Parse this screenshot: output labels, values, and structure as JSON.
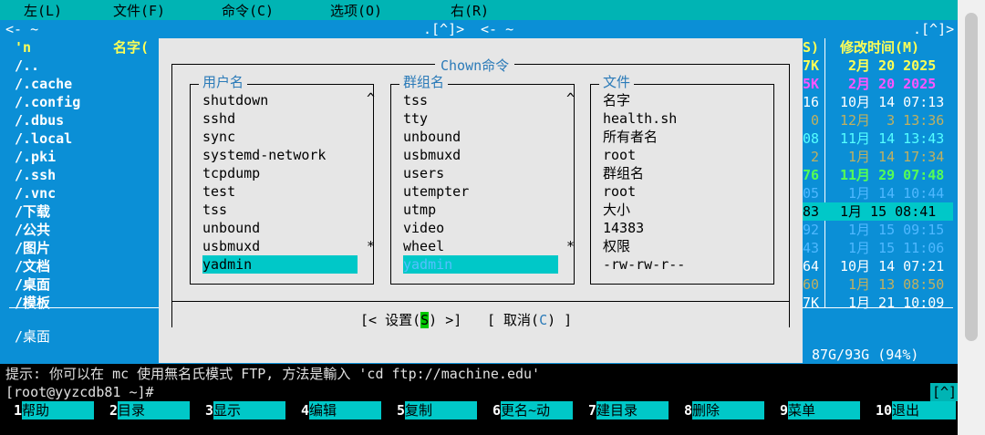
{
  "menu": [
    "左(L)",
    "文件(F)",
    "命令(C)",
    "选项(O)",
    "右(R)"
  ],
  "left_panel": {
    "path_left": "<- ~",
    "path_right": ".[^]>",
    "col_name_marker": "'n",
    "col_name": "名字(",
    "files": [
      "/..",
      "/.cache",
      "/.config",
      "/.dbus",
      "/.local",
      "/.pki",
      "/.ssh",
      "/.vnc",
      "/下载",
      "/公共",
      "/图片",
      "/文档",
      "/桌面",
      "/模板"
    ],
    "footer": "/桌面"
  },
  "right_panel": {
    "path_left": "<- ~",
    "path_right": ".[^]>",
    "col_size": "S)",
    "col_mtime": "修改时间(M)",
    "rows": [
      {
        "size": "7K",
        "time": "2月 20 2025",
        "color": "yellow"
      },
      {
        "size": "5K",
        "time": "2月 20 2025",
        "color": "magenta"
      },
      {
        "size": "16",
        "time": "10月 14 07:13",
        "color": "white"
      },
      {
        "size": "0",
        "time": "12月  3 13:36",
        "color": "olive"
      },
      {
        "size": "08",
        "time": "11月 14 13:43",
        "color": "cyan"
      },
      {
        "size": "2",
        "time": "1月 14 17:34",
        "color": "olive"
      },
      {
        "size": "76",
        "time": "11月 29 07:48",
        "color": "green"
      },
      {
        "size": "05",
        "time": "1月 14 10:44",
        "color": "lt"
      },
      {
        "size": "83",
        "time": "1月 15 08:41",
        "color": "selected"
      },
      {
        "size": "92",
        "time": "1月 15 09:15",
        "color": "lt"
      },
      {
        "size": "43",
        "time": "1月 15 11:06",
        "color": "lt"
      },
      {
        "size": "64",
        "time": "10月 14 07:21",
        "color": "white"
      },
      {
        "size": "60",
        "time": "1月 13 08:50",
        "color": "olive"
      },
      {
        "size": "7K",
        "time": "1月 21 10:09",
        "color": "white"
      }
    ],
    "footer": "87G/93G (94%)"
  },
  "dialog": {
    "title": "Chown命令",
    "user_label": "用户名",
    "users": [
      "shutdown",
      "sshd",
      "sync",
      "systemd-network",
      "tcpdump",
      "test",
      "tss",
      "unbound",
      "usbmuxd",
      "yadmin"
    ],
    "group_label": "群组名",
    "groups": [
      "tss",
      "tty",
      "unbound",
      "usbmuxd",
      "users",
      "utempter",
      "utmp",
      "video",
      "wheel",
      "yadmin"
    ],
    "file_label": "文件",
    "file_info": [
      "名字",
      "health.sh",
      "所有者名",
      "root",
      "群组名",
      "root",
      "大小",
      "14383",
      "权限",
      "-rw-rw-r--"
    ],
    "set_button": {
      "pre": "[< 设置(",
      "hot": "S",
      "post": ") >]"
    },
    "cancel_button": {
      "pre": "[ 取消(",
      "hot": "C",
      "post": ") ]"
    }
  },
  "hint": "提示: 你可以在 mc 使用無名氏模式 FTP, 方法是輸入 'cd ftp://machine.edu'",
  "prompt": "[root@yyzcdb81 ~]#",
  "prompt_badge": "[^]",
  "fkeys": [
    {
      "num": "1",
      "label": "帮助"
    },
    {
      "num": "2",
      "label": "目录"
    },
    {
      "num": "3",
      "label": "显示"
    },
    {
      "num": "4",
      "label": "编辑"
    },
    {
      "num": "5",
      "label": "复制"
    },
    {
      "num": "6",
      "label": "更名~动"
    },
    {
      "num": "7",
      "label": "建目录"
    },
    {
      "num": "8",
      "label": "删除"
    },
    {
      "num": "9",
      "label": "菜单"
    },
    {
      "num": "10",
      "label": "退出"
    }
  ]
}
